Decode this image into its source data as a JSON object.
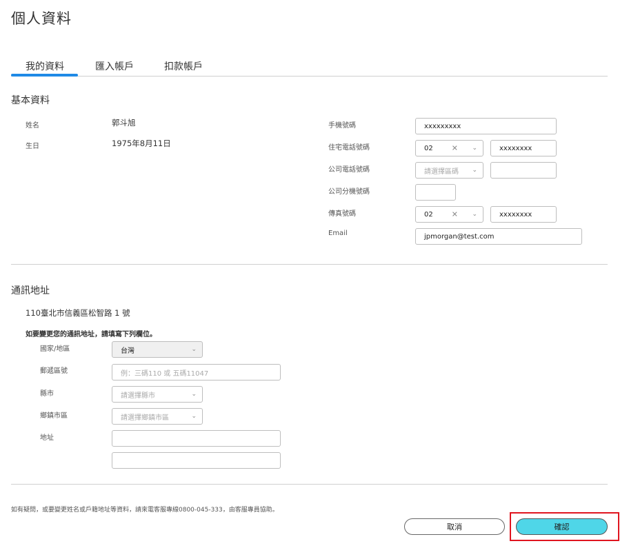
{
  "page": {
    "title": "個人資料"
  },
  "tabs": [
    {
      "label": "我的資料",
      "active": true
    },
    {
      "label": "匯入帳戶",
      "active": false
    },
    {
      "label": "扣款帳戶",
      "active": false
    }
  ],
  "basic": {
    "section_title": "基本資料",
    "name_label": "姓名",
    "name_value": "郭斗旭",
    "birth_label": "生日",
    "birth_value": "1975年8月11日",
    "mobile_label": "手機號碼",
    "mobile_value": "xxxxxxxxx",
    "home_label": "住宅電話號碼",
    "home_area": "02",
    "home_number": "xxxxxxxx",
    "office_label": "公司電話號碼",
    "office_area_placeholder": "請選擇區碼",
    "office_number": "",
    "ext_label": "公司分機號碼",
    "ext_value": "",
    "fax_label": "傳真號碼",
    "fax_area": "02",
    "fax_number": "xxxxxxxx",
    "email_label": "Email",
    "email_value": "jpmorgan@test.com"
  },
  "address": {
    "section_title": "通訊地址",
    "current": "110臺北市信義區松智路 1 號",
    "instruction": "如要變更您的通訊地址，請填寫下列欄位。",
    "country_label": "國家/地區",
    "country_value": "台灣",
    "postal_label": "郵遞區號",
    "postal_placeholder": "例：三碼110 或 五碼11047",
    "city_label": "縣市",
    "city_placeholder": "請選擇縣市",
    "district_label": "鄉鎮市區",
    "district_placeholder": "請選擇鄉鎮市區",
    "street_label": "地址",
    "street1": "",
    "street2": ""
  },
  "footer": {
    "note": "如有疑問，或要變更姓名或戶籍地址等資料，請來電客服專線0800-045-333，由客服專員協助。",
    "cancel_label": "取消",
    "confirm_label": "確認"
  },
  "icons": {
    "clear": "✕",
    "chevron": "⌄"
  },
  "colors": {
    "tab_active": "#1f8ae6",
    "confirm_bg": "#4fd6e8",
    "highlight": "#e0141e"
  }
}
